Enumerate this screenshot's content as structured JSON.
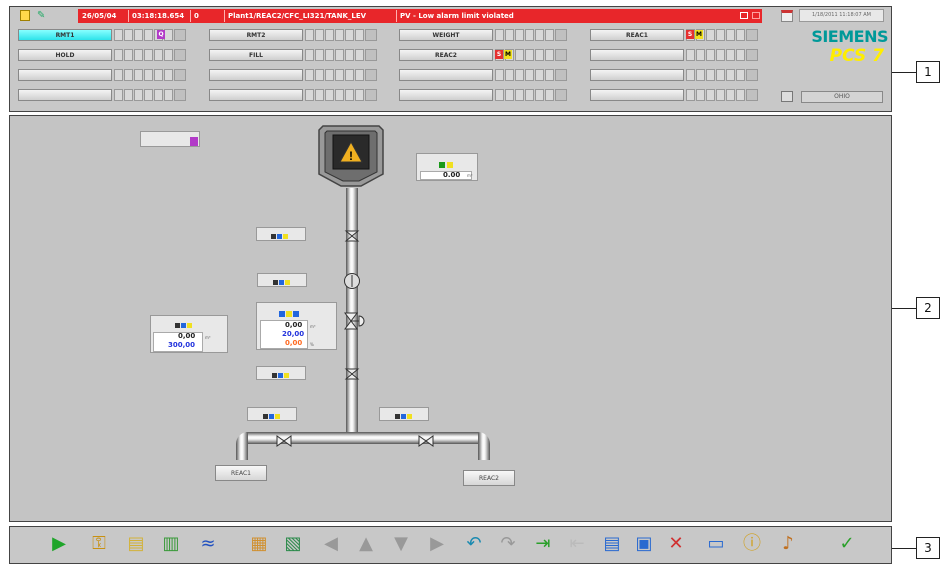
{
  "overview": {
    "alarm_line": {
      "date": "26/05/04",
      "time": "03:18:18.654",
      "state": "0",
      "tag": "Plant1/REAC2/CFC_LI321/TANK_LEV",
      "message": "PV - Low alarm limit violated"
    },
    "datetime": "1/18/2011 11:18:07 AM",
    "brand": "SIEMENS",
    "product": "PCS 7",
    "server": "OHIO",
    "areas": [
      {
        "label": "RMT1",
        "active": true,
        "badges": [
          "Q"
        ]
      },
      {
        "label": "RMT2",
        "active": false,
        "badges": []
      },
      {
        "label": "WEIGHT",
        "active": false,
        "badges": []
      },
      {
        "label": "REAC1",
        "active": false,
        "badges": [
          "S",
          "M"
        ]
      },
      {
        "label": "HOLD",
        "active": false,
        "badges": []
      },
      {
        "label": "FILL",
        "active": false,
        "badges": []
      },
      {
        "label": "REAC2",
        "active": false,
        "badges": [
          "S",
          "M"
        ]
      }
    ]
  },
  "workspace": {
    "monitor_top": {
      "value": "0.00",
      "unit": "m³"
    },
    "monitor_left": {
      "value1": "0,00",
      "unit": "m³",
      "value2": "300,00"
    },
    "controller": {
      "pv": "0,00",
      "pv_unit": "m³",
      "sp": "20,00",
      "out": "0,00",
      "out_unit": "%"
    },
    "targets": [
      "REAC1",
      "REAC2"
    ]
  },
  "callouts": [
    "1",
    "2",
    "3"
  ],
  "colors": {
    "alarm": "#e8262a",
    "active_area": "#2ee3ea",
    "brand": "#009999",
    "product": "#ffee00"
  }
}
